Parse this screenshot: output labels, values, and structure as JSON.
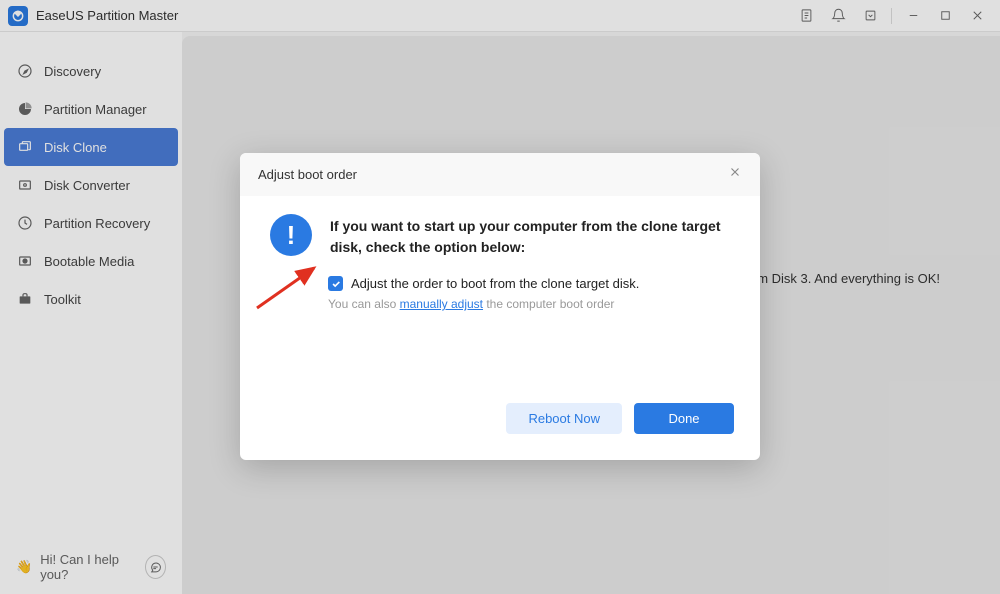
{
  "app": {
    "title": "EaseUS Partition Master"
  },
  "sidebar": {
    "items": [
      {
        "label": "Discovery"
      },
      {
        "label": "Partition Manager"
      },
      {
        "label": "Disk Clone"
      },
      {
        "label": "Disk Converter"
      },
      {
        "label": "Partition Recovery"
      },
      {
        "label": "Bootable Media"
      },
      {
        "label": "Toolkit"
      }
    ],
    "help": "Hi! Can I help you?"
  },
  "content": {
    "bg_text": "rom Disk 3. And everything is OK!"
  },
  "dialog": {
    "title": "Adjust boot order",
    "hero": "If you want to start up your computer from the clone target disk, check the option below:",
    "checkbox_label": "Adjust the order to boot from the clone target disk.",
    "sub_pre": "You can also ",
    "sub_link": "manually adjust",
    "sub_post": " the computer boot order",
    "reboot": "Reboot Now",
    "done": "Done"
  }
}
